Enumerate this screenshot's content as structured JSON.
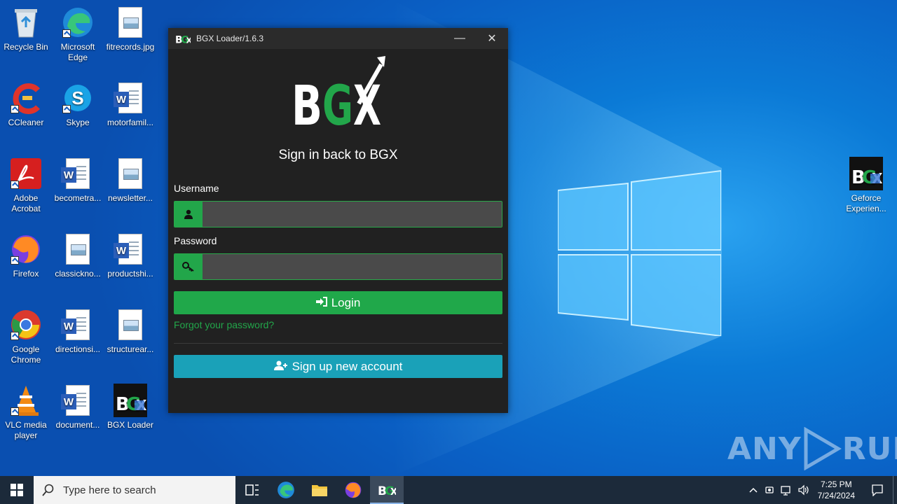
{
  "desktop": {
    "icons": [
      {
        "label": "Recycle Bin"
      },
      {
        "label": "Microsoft Edge"
      },
      {
        "label": "fitrecords.jpg"
      },
      {
        "label": "CCleaner"
      },
      {
        "label": "Skype"
      },
      {
        "label": "motorfamil..."
      },
      {
        "label": "Adobe Acrobat"
      },
      {
        "label": "becometra..."
      },
      {
        "label": "newsletter..."
      },
      {
        "label": "Firefox"
      },
      {
        "label": "classickno..."
      },
      {
        "label": "productshi..."
      },
      {
        "label": "Google Chrome"
      },
      {
        "label": "directionsi..."
      },
      {
        "label": "structurear..."
      },
      {
        "label": "VLC media player"
      },
      {
        "label": "document..."
      },
      {
        "label": "BGX Loader"
      },
      {
        "label": "Geforce Experien..."
      }
    ]
  },
  "window": {
    "title": "BGX Loader/1.6.3",
    "minimize": "—",
    "close": "✕"
  },
  "login": {
    "brand": "BGX",
    "subtitle": "Sign in back to BGX",
    "username_label": "Username",
    "username_value": "",
    "password_label": "Password",
    "password_value": "",
    "login_button": "Login",
    "forgot_link": "Forgot your password?",
    "signup_button": "Sign up new account"
  },
  "watermark": {
    "left": "ANY",
    "right": "RUN"
  },
  "taskbar": {
    "search_placeholder": "Type here to search",
    "time": "7:25 PM",
    "date": "7/24/2024"
  },
  "colors": {
    "accent_green": "#20a84a",
    "accent_teal": "#1aa1b8",
    "window_bg": "#212121"
  }
}
